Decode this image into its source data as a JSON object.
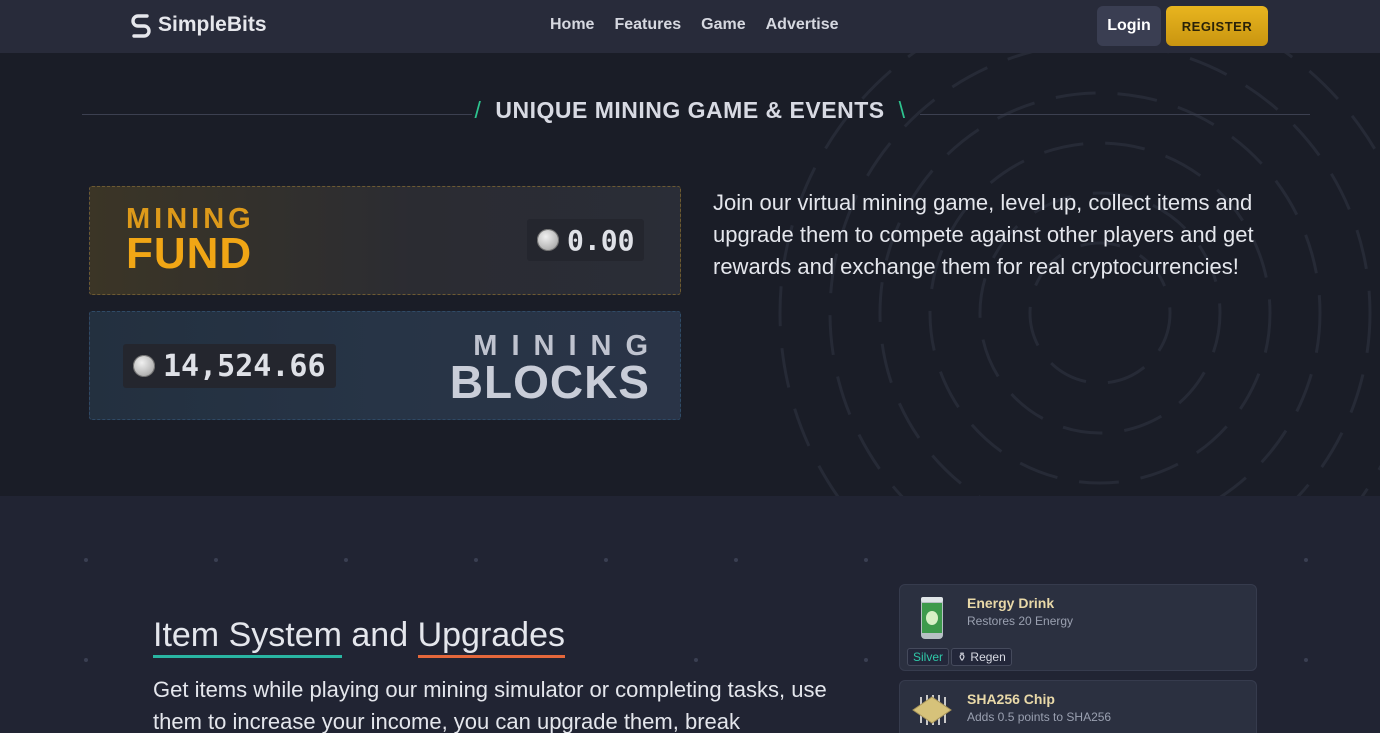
{
  "nav": {
    "brand": "SimpleBits",
    "links": [
      "Home",
      "Features",
      "Game",
      "Advertise"
    ],
    "login_label": "Login",
    "register_label": "REGISTER"
  },
  "hero": {
    "heading": "UNIQUE MINING GAME & EVENTS",
    "fund": {
      "label_top": "MINING",
      "label_bottom": "FUND",
      "amount": "0.00"
    },
    "blocks": {
      "label_top": "MINING",
      "label_bottom": "BLOCKS",
      "amount": "14,524.66"
    },
    "description": "Join our virtual mining game, level up, collect items and upgrade them to compete against other players and get rewards and exchange them for real cryptocurrencies!"
  },
  "items_section": {
    "title_part1": "Item System",
    "title_part2": "and",
    "title_part3": "Upgrades",
    "description": "Get items while playing our mining simulator or completing tasks, use them to increase your income, you can upgrade them, break",
    "cards": [
      {
        "name": "Energy Drink",
        "subtitle": "Restores 20 Energy",
        "tags": [
          "Silver",
          "Regen"
        ]
      },
      {
        "name": "SHA256 Chip",
        "subtitle": "Adds 0.5 points to SHA256"
      }
    ]
  },
  "colors": {
    "accent_gold": "#e8b51f",
    "accent_teal": "#2dc38e",
    "accent_orange": "#e4673b",
    "background": "#1a1d27"
  }
}
